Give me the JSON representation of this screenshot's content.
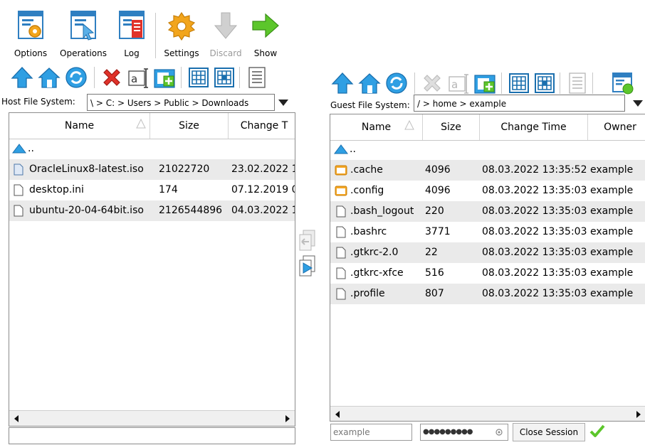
{
  "toolbar": {
    "options": "Options",
    "operations": "Operations",
    "log": "Log",
    "settings": "Settings",
    "discard": "Discard",
    "show": "Show"
  },
  "host": {
    "label": "Host File System:",
    "path": "\\ > C: > Users > Public > Downloads",
    "columns": [
      "Name",
      "Size",
      "Change T"
    ],
    "parent": "..",
    "files": [
      {
        "name": "OracleLinux8-latest.iso",
        "size": "21022720",
        "changed": "23.02.2022 1"
      },
      {
        "name": "desktop.ini",
        "size": "174",
        "changed": "07.12.2019 0"
      },
      {
        "name": "ubuntu-20-04-64bit.iso",
        "size": "2126544896",
        "changed": "04.03.2022 1"
      }
    ]
  },
  "guest": {
    "label": "Guest File System:",
    "path": "/ > home > example",
    "columns": [
      "Name",
      "Size",
      "Change Time",
      "Owner"
    ],
    "parent": "..",
    "files": [
      {
        "name": ".cache",
        "size": "4096",
        "changed": "08.03.2022 13:35:52",
        "owner": "example",
        "type": "folder"
      },
      {
        "name": ".config",
        "size": "4096",
        "changed": "08.03.2022 13:35:03",
        "owner": "example",
        "type": "folder"
      },
      {
        "name": ".bash_logout",
        "size": "220",
        "changed": "08.03.2022 13:35:03",
        "owner": "example",
        "type": "file"
      },
      {
        "name": ".bashrc",
        "size": "3771",
        "changed": "08.03.2022 13:35:03",
        "owner": "example",
        "type": "file"
      },
      {
        "name": ".gtkrc-2.0",
        "size": "22",
        "changed": "08.03.2022 13:35:03",
        "owner": "example",
        "type": "file"
      },
      {
        "name": ".gtkrc-xfce",
        "size": "516",
        "changed": "08.03.2022 13:35:03",
        "owner": "example",
        "type": "file"
      },
      {
        "name": ".profile",
        "size": "807",
        "changed": "08.03.2022 13:35:03",
        "owner": "example",
        "type": "file"
      }
    ]
  },
  "session": {
    "username_placeholder": "example",
    "password_mask": "●●●●●●●●●",
    "close_label": "Close Session"
  },
  "colors": {
    "accent_blue": "#2f9fe3",
    "settings_orange": "#f2a51c",
    "show_green": "#5cc62b",
    "delete_red": "#e0322a",
    "folder_orange": "#f5a623",
    "row_alt": "#eaeaea"
  }
}
